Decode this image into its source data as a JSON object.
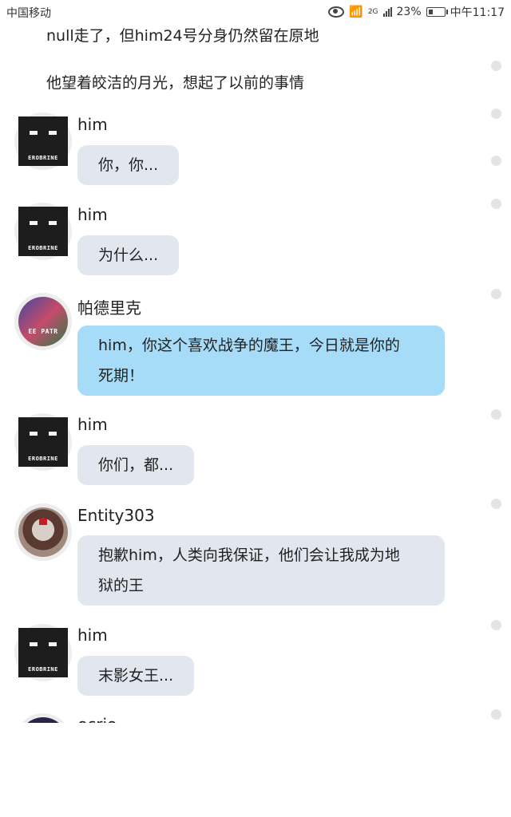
{
  "status_bar": {
    "carrier": "中国移动",
    "network": "2G",
    "battery": "23%",
    "time": "中午11:17"
  },
  "narration": [
    "null走了，但him24号分身仍然留在原地",
    "他望着皎洁的月光，想起了以前的事情"
  ],
  "messages": [
    {
      "sender": "him",
      "avatar": "herobrine-avatar",
      "avatar_text": "EROBRINE",
      "text": [
        "你，你..."
      ]
    },
    {
      "sender": "him",
      "avatar": "herobrine-avatar",
      "avatar_text": "EROBRINE",
      "text": [
        "为什么..."
      ]
    },
    {
      "sender": "帕德里克",
      "avatar": "patrick-avatar",
      "avatar_text": "EE PATR",
      "text": [
        "him，你这个喜欢战争的魔王，今日就是你的",
        "死期！"
      ],
      "highlight": true
    },
    {
      "sender": "him",
      "avatar": "herobrine-avatar",
      "avatar_text": "EROBRINE",
      "text": [
        "你们，都..."
      ]
    },
    {
      "sender": "Entity303",
      "avatar": "entity303-avatar",
      "avatar_text": "",
      "text": [
        "抱歉him，人类向我保证，他们会让我成为地",
        "狱的王"
      ]
    },
    {
      "sender": "him",
      "avatar": "herobrine-avatar",
      "avatar_text": "EROBRINE",
      "text": [
        "末影女王..."
      ]
    },
    {
      "sender": "ecrio",
      "avatar": "partial-avatar",
      "avatar_text": "",
      "text": []
    }
  ],
  "colors": {
    "bubble_default": "#e2e6ee",
    "bubble_highlight": "#a6dcf8",
    "scroll_dot": "#e4e4e4"
  }
}
